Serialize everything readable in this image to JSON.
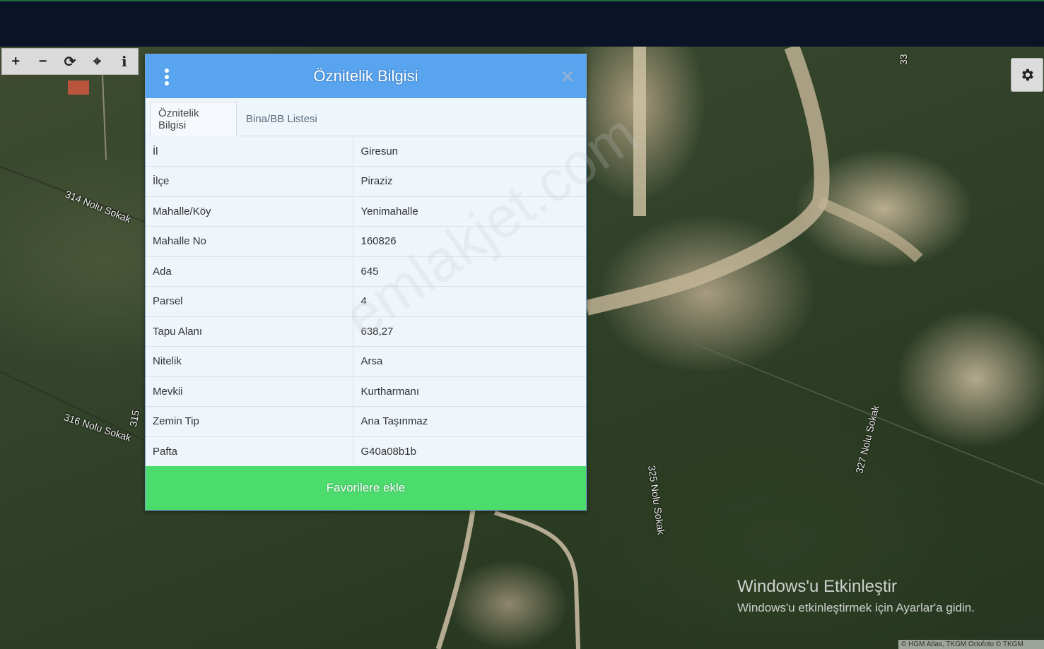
{
  "toolbar": {
    "zoom_in": "+",
    "zoom_out": "−",
    "refresh": "⟳",
    "locate": "⌖",
    "info": "i"
  },
  "panel": {
    "title": "Öznitelik Bilgisi",
    "tabs": [
      {
        "label": "Öznitelik Bilgisi",
        "active": true
      },
      {
        "label": "Bina/BB Listesi",
        "active": false
      }
    ],
    "rows": [
      {
        "key": "İl",
        "value": "Giresun"
      },
      {
        "key": "İlçe",
        "value": "Piraziz"
      },
      {
        "key": "Mahalle/Köy",
        "value": "Yenimahalle"
      },
      {
        "key": "Mahalle No",
        "value": "160826"
      },
      {
        "key": "Ada",
        "value": "645"
      },
      {
        "key": "Parsel",
        "value": "4"
      },
      {
        "key": "Tapu Alanı",
        "value": "638,27"
      },
      {
        "key": "Nitelik",
        "value": "Arsa"
      },
      {
        "key": "Mevkii",
        "value": "Kurtharmanı"
      },
      {
        "key": "Zemin Tip",
        "value": "Ana Taşınmaz"
      },
      {
        "key": "Pafta",
        "value": "G40a08b1b"
      }
    ],
    "favorite_button": "Favorilere ekle"
  },
  "map": {
    "streets": [
      "314 Nolu Sokak",
      "316 Nolu Sokak",
      "315",
      "325 Nolu Sokak",
      "327 Nolu Sokak",
      "33"
    ],
    "watermark": "emlakjet.com",
    "attribution": "© HGM Atlas, TKGM Ortofoto © TKGM"
  },
  "windows_activation": {
    "title": "Windows'u Etkinleştir",
    "subtitle": "Windows'u etkinleştirmek için Ayarlar'a gidin."
  },
  "colors": {
    "header": "#58a4ee",
    "favorite": "#4cdc6e",
    "topbar": "#0b1326"
  }
}
